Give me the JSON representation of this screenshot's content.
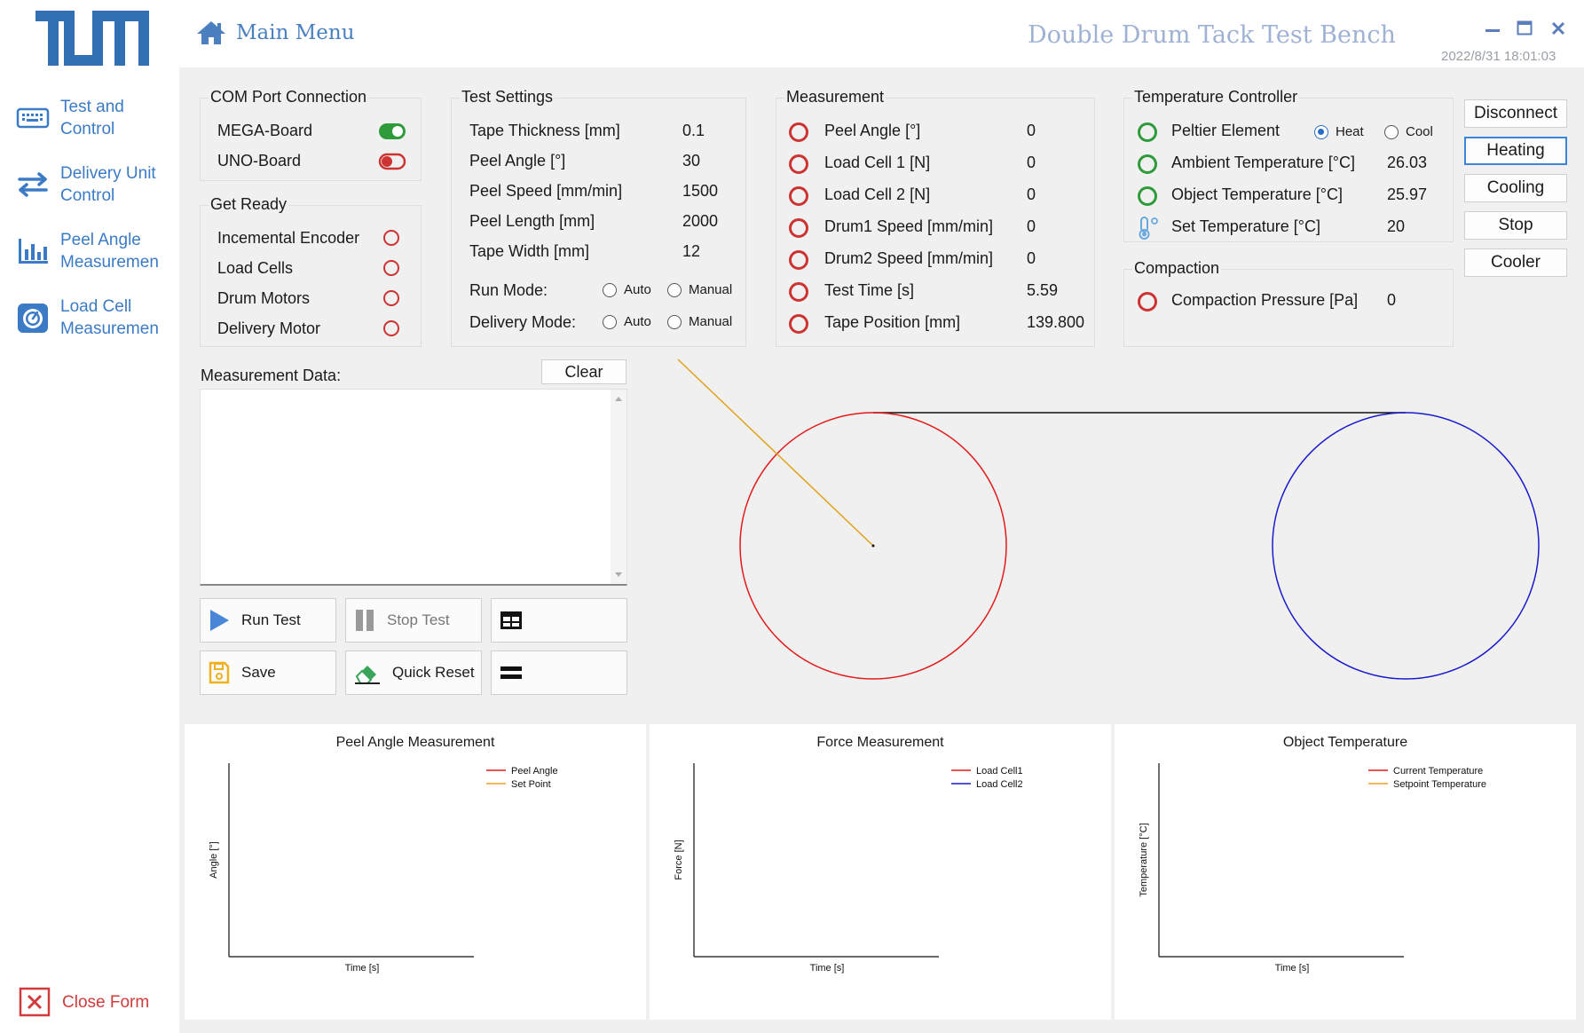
{
  "window": {
    "title": "Double Drum Tack Test Bench",
    "datetime": "2022/8/31 18:01:03",
    "minimize_icon": "minimize-icon",
    "maximize_icon": "maximize-icon",
    "close_icon": "close-icon"
  },
  "header": {
    "home_label": "Main Menu"
  },
  "logo": {
    "text": "TUM"
  },
  "sidebar": {
    "items": [
      {
        "label_line1": "Test and",
        "label_line2": "Control",
        "icon": "keyboard-icon"
      },
      {
        "label_line1": "Delivery Unit",
        "label_line2": "Control",
        "icon": "transfer-arrows-icon"
      },
      {
        "label_line1": "Peel Angle",
        "label_line2": "Measuremen",
        "icon": "bar-chart-icon"
      },
      {
        "label_line1": "Load Cell",
        "label_line2": "Measuremen",
        "icon": "gauge-icon"
      }
    ],
    "close_label": "Close Form"
  },
  "com_port": {
    "title": "COM Port Connection",
    "mega": {
      "label": "MEGA-Board",
      "state": "on"
    },
    "uno": {
      "label": "UNO-Board",
      "state": "off"
    }
  },
  "get_ready": {
    "title": "Get Ready",
    "items": [
      "Incemental Encoder",
      "Load Cells",
      "Drum Motors",
      "Delivery Motor"
    ]
  },
  "test_settings": {
    "title": "Test Settings",
    "rows": [
      {
        "label": "Tape Thickness [mm]",
        "value": "0.1"
      },
      {
        "label": "Peel Angle [°]",
        "value": "30"
      },
      {
        "label": "Peel Speed [mm/min]",
        "value": "1500"
      },
      {
        "label": "Peel Length [mm]",
        "value": "2000"
      },
      {
        "label": "Tape Width [mm]",
        "value": "12"
      }
    ],
    "run_mode": {
      "label": "Run Mode:",
      "opt1": "Auto",
      "opt2": "Manual"
    },
    "delivery_mode": {
      "label": "Delivery Mode:",
      "opt1": "Auto",
      "opt2": "Manual"
    }
  },
  "measurement": {
    "title": "Measurement",
    "rows": [
      {
        "label": "Peel Angle [°]",
        "value": "0"
      },
      {
        "label": "Load Cell 1 [N]",
        "value": "0"
      },
      {
        "label": "Load Cell 2 [N]",
        "value": "0"
      },
      {
        "label": "Drum1 Speed [mm/min]",
        "value": "0"
      },
      {
        "label": "Drum2 Speed [mm/min]",
        "value": "0"
      },
      {
        "label": "Test Time [s]",
        "value": "5.59"
      },
      {
        "label": "Tape Position [mm]",
        "value": "139.800"
      }
    ]
  },
  "temperature_controller": {
    "title": "Temperature Controller",
    "peltier": {
      "label": "Peltier Element",
      "heat": "Heat",
      "cool": "Cool",
      "selected": "Heat"
    },
    "ambient": {
      "label": "Ambient Temperature [°C]",
      "value": "26.03"
    },
    "object": {
      "label": "Object Temperature [°C]",
      "value": "25.97"
    },
    "set": {
      "label": "Set Temperature [°C]",
      "value": "20",
      "icon": "thermometer-icon"
    }
  },
  "compaction": {
    "title": "Compaction",
    "pressure": {
      "label": "Compaction Pressure [Pa]",
      "value": "0"
    }
  },
  "right_buttons": {
    "disconnect": "Disconnect",
    "heating": "Heating",
    "cooling": "Cooling",
    "stop": "Stop",
    "cooler": "Cooler"
  },
  "measurement_data": {
    "label": "Measurement Data:",
    "clear": "Clear",
    "text": ""
  },
  "actions": {
    "run_test": "Run Test",
    "stop_test": "Stop Test",
    "save": "Save",
    "quick_reset": "Quick Reset",
    "table_icon": "table-icon",
    "menu_icon": "equals-icon"
  },
  "colors": {
    "accent": "#3b7bc6",
    "drum1": "#e31a1a",
    "drum2": "#1a1acc",
    "tape": "#e0a11a",
    "status_red": "#cc3333",
    "status_green": "#2e9b3a"
  },
  "chart_data": [
    {
      "type": "line",
      "title": "Peel Angle Measurement",
      "xlabel": "Time [s]",
      "ylabel": "Angle [°]",
      "series": [
        {
          "name": "Peel Angle",
          "color": "#e31a1a",
          "values": []
        },
        {
          "name": "Set Point",
          "color": "#f0a020",
          "values": []
        }
      ],
      "legend": "top-right",
      "grid": false
    },
    {
      "type": "line",
      "title": "Force Measurement",
      "xlabel": "Time [s]",
      "ylabel": "Force [N]",
      "series": [
        {
          "name": "Load Cell1",
          "color": "#e31a1a",
          "values": []
        },
        {
          "name": "Load Cell2",
          "color": "#1a1acc",
          "values": []
        }
      ],
      "legend": "top-right",
      "grid": false
    },
    {
      "type": "line",
      "title": "Object Temperature",
      "xlabel": "Time [s]",
      "ylabel": "Temperature [°C]",
      "series": [
        {
          "name": "Current Temperature",
          "color": "#e31a1a",
          "values": []
        },
        {
          "name": "Setpoint Temperature",
          "color": "#f0a020",
          "values": []
        }
      ],
      "legend": "top-right",
      "grid": false
    }
  ]
}
